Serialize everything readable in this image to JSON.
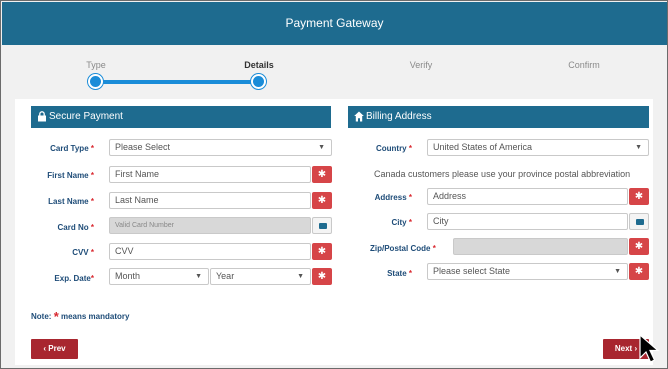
{
  "header": {
    "title": "Payment Gateway"
  },
  "steps": [
    {
      "label": "Type"
    },
    {
      "label": "Details"
    },
    {
      "label": "Verify"
    },
    {
      "label": "Confirm"
    }
  ],
  "left_panel": {
    "title": "Secure Payment",
    "fields": {
      "card_type": {
        "label": "Card Type",
        "value": "Please Select"
      },
      "first_name": {
        "label": "First Name",
        "placeholder": "First Name"
      },
      "last_name": {
        "label": "Last Name",
        "placeholder": "Last Name"
      },
      "card_no": {
        "label": "Card No",
        "placeholder": "Valid Card Number"
      },
      "cvv": {
        "label": "CVV",
        "placeholder": "CVV"
      },
      "exp_date": {
        "label": "Exp. Date",
        "month": "Month",
        "year": "Year"
      }
    }
  },
  "right_panel": {
    "title": "Billing Address",
    "fields": {
      "country": {
        "label": "Country",
        "value": "United States of America"
      },
      "info": "Canada customers please use your province postal abbreviation",
      "address": {
        "label": "Address",
        "placeholder": "Address"
      },
      "city": {
        "label": "City",
        "placeholder": "City"
      },
      "zip": {
        "label": "Zip/Postal Code"
      },
      "state": {
        "label": "State",
        "value": "Please select State"
      }
    }
  },
  "note": {
    "prefix": "Note:",
    "suffix": "means mandatory"
  },
  "nav": {
    "prev": "Prev",
    "next": "Next"
  },
  "colors": {
    "header": "#1e6b8f",
    "accent": "#1a8cd8",
    "required": "#d9282f",
    "button": "#a8262f"
  }
}
